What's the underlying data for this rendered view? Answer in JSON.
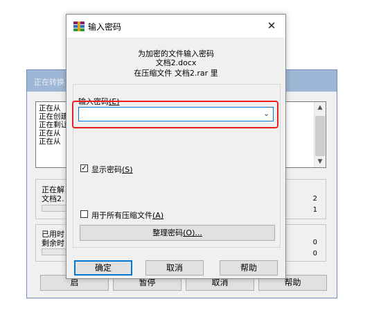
{
  "background_window": {
    "title": "正在转换",
    "log_lines": [
      "正在从",
      "正在创建",
      "正在剩让",
      "正在从",
      "正在从"
    ],
    "group1": {
      "line1": "正在解",
      "line2": "文档2.",
      "num1": "2",
      "num2": "1"
    },
    "group2": {
      "line1": "已用时",
      "line2": "剩余时",
      "num1": "0",
      "num2": "0"
    },
    "buttons": {
      "start": "启",
      "pause": "暂停",
      "cancel": "取消",
      "help": "帮助"
    }
  },
  "dialog": {
    "title": "输入密码",
    "close_glyph": "✕",
    "message": {
      "line1": "为加密的文件输入密码",
      "line2": "文档2.docx",
      "line3": "在压缩文件 文档2.rar 里"
    },
    "password": {
      "label": "输入密码",
      "mnemonic": "(E)",
      "value": "",
      "dropdown_glyph": "⌄"
    },
    "show_password": {
      "label": "显示密码",
      "mnemonic": "(S)",
      "checked": true
    },
    "all_archives": {
      "label": "用于所有压缩文件",
      "mnemonic": "(A)",
      "checked": false
    },
    "organize_button": {
      "label": "整理密码",
      "mnemonic": "(O)..."
    },
    "buttons": {
      "ok": "确定",
      "cancel": "取消",
      "help": "帮助"
    }
  },
  "colors": {
    "highlight": "#e8201f",
    "focus": "#0078d7"
  },
  "icons": {
    "app": "winrar-icon",
    "close": "close-icon",
    "check": "checkmark-icon"
  }
}
